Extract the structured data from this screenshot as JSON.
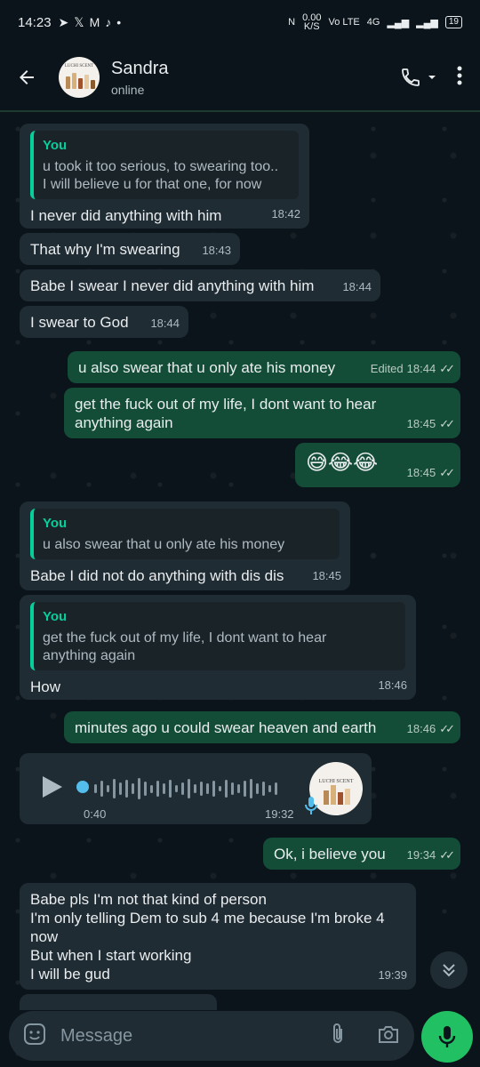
{
  "status_bar": {
    "time": "14:23",
    "net_speed_top": "0.00",
    "net_speed_bottom": "K/S",
    "volte": "Vo LTE",
    "network": "4G",
    "battery": "19"
  },
  "header": {
    "contact_name": "Sandra",
    "contact_status": "online",
    "avatar_logo_text": "LUCHI SCENT"
  },
  "messages": [
    {
      "dir": "in",
      "quote_author": "You",
      "quote_text": "u took it too serious, to swearing too..\nI will believe u for that one, for now",
      "text": "I never did anything with him",
      "time": "18:42"
    },
    {
      "dir": "in",
      "text": "That why I'm swearing",
      "time": "18:43"
    },
    {
      "dir": "in",
      "text": "Babe I swear I never did anything with him",
      "time": "18:44"
    },
    {
      "dir": "in",
      "text": "I swear to God",
      "time": "18:44"
    },
    {
      "dir": "out",
      "text": "u also swear that u only ate his money",
      "edited": "Edited",
      "time": "18:44"
    },
    {
      "dir": "out",
      "text": "get the fuck out of my life, I dont want to hear anything again",
      "time": "18:45"
    },
    {
      "dir": "out",
      "text": "😅😂😂",
      "time": "18:45"
    },
    {
      "dir": "in",
      "quote_author": "You",
      "quote_text": "u also swear that u only ate his money",
      "text": "Babe I did not do anything with dis dis",
      "time": "18:45"
    },
    {
      "dir": "in",
      "quote_author": "You",
      "quote_text": "get the fuck out of my life, I dont want to hear anything again",
      "text": "How",
      "time": "18:46"
    },
    {
      "dir": "out",
      "text": "minutes ago u could swear heaven and earth",
      "time": "18:46"
    },
    {
      "dir": "in",
      "type": "voice",
      "duration": "0:40",
      "time": "19:32"
    },
    {
      "dir": "out",
      "text": "Ok, i believe you",
      "time": "19:34"
    },
    {
      "dir": "in",
      "text": "Babe pls I'm not that kind of person\nI'm only telling Dem to sub 4 me because I'm broke 4 now\nBut when I start working\nI will be gud",
      "time": "19:39"
    }
  ],
  "composer": {
    "placeholder": "Message"
  },
  "colors": {
    "incoming_bubble": "#202c33",
    "outgoing_bubble": "#144d37",
    "accent": "#21c063",
    "quote_accent": "#06cf9c"
  }
}
